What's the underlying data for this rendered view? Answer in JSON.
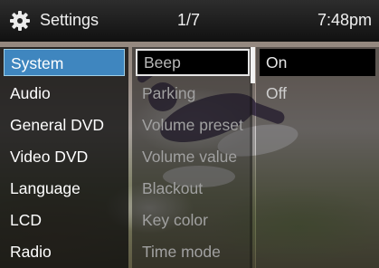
{
  "header": {
    "title": "Settings",
    "page": "1/7",
    "clock": "7:48pm",
    "icon": "gear-icon"
  },
  "categories": {
    "items": [
      "System",
      "Audio",
      "General DVD",
      "Video DVD",
      "Language",
      "LCD",
      "Radio"
    ],
    "selected": "System"
  },
  "options": {
    "items": [
      "Beep",
      "Parking",
      "Volume preset",
      "Volume value",
      "Blackout",
      "Key color",
      "Time mode"
    ],
    "selected": "Beep"
  },
  "values": {
    "items": [
      "On",
      "Off"
    ],
    "selected": "On"
  },
  "colors": {
    "selection": "#3f86bf",
    "header": "#1a1a1a"
  }
}
